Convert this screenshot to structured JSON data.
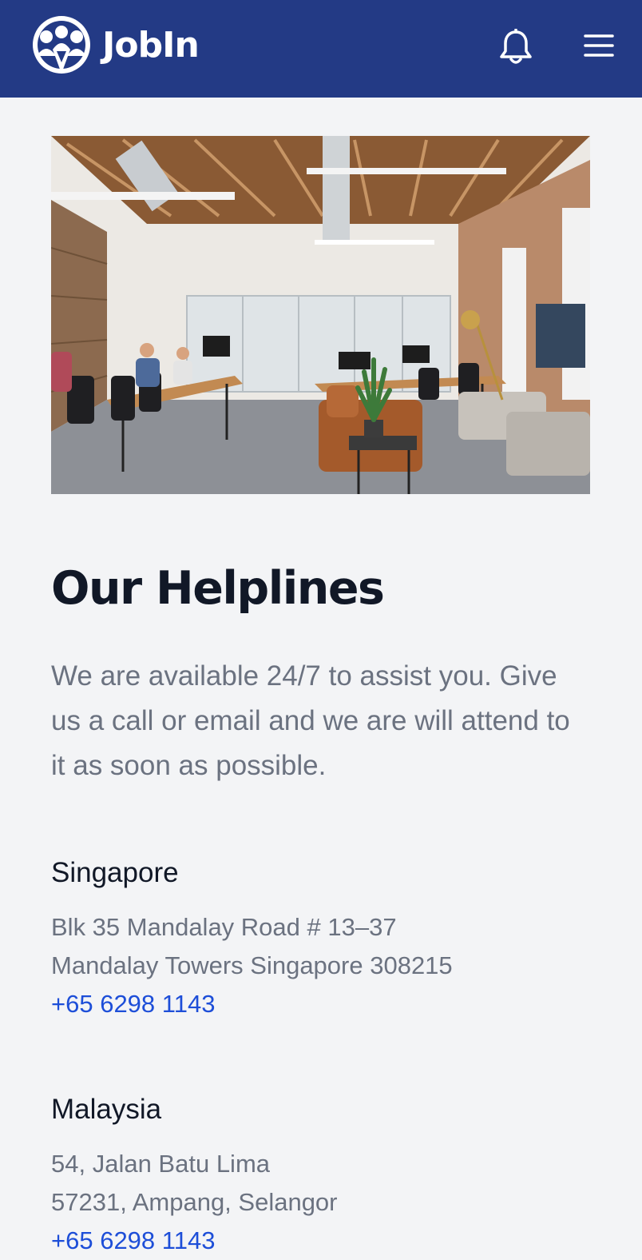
{
  "header": {
    "logo_text": "JobIn",
    "bell_icon": "bell-icon",
    "menu_icon": "hamburger-menu-icon",
    "background": "#233a85"
  },
  "hero": {
    "image": "office-interior-photo"
  },
  "main": {
    "title": "Our Helplines",
    "intro": "We are available 24/7 to assist you. Give us a call or email and we are will attend to it as soon as possible."
  },
  "offices": [
    {
      "name": "Singapore",
      "address_line1": "Blk 35 Mandalay Road # 13–37",
      "address_line2": "Mandalay Towers Singapore 308215",
      "phone": "+65 6298 1143"
    },
    {
      "name": "Malaysia",
      "address_line1": "54, Jalan Batu Lima",
      "address_line2": "57231, Ampang, Selangor",
      "phone": "+65 6298 1143"
    }
  ],
  "colors": {
    "link": "#1d4ed8",
    "heading": "#111827",
    "body_text": "#6b7280"
  }
}
